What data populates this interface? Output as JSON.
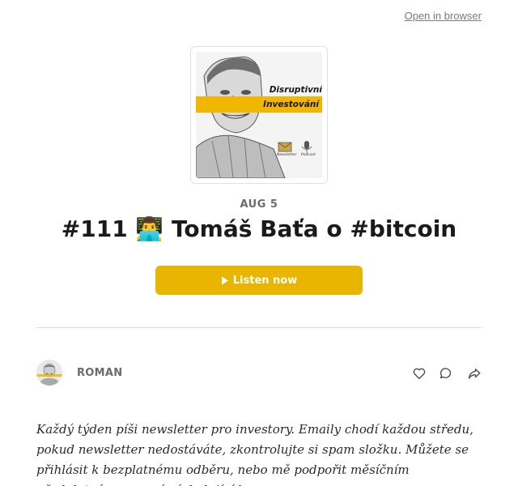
{
  "header": {
    "open_in_browser": "Open in browser"
  },
  "cover": {
    "title_line1": "Disruptivní",
    "title_line2": "Investování",
    "label_newsletter": "Newsletter",
    "label_podcast": "Podcast",
    "band_color": "#f1b600"
  },
  "post": {
    "date": "AUG 5",
    "title": "#111 👨‍💻 Tomáš Baťa o #bitcoin",
    "listen_label": "Listen now"
  },
  "author": {
    "name": "ROMAN"
  },
  "actions": {
    "icons": [
      "heart-icon",
      "comment-icon",
      "share-icon"
    ]
  },
  "body": {
    "text": "Každý týden píši newsletter pro investory. Emaily chodí každou středu, pokud newsletter nedostáváte, zkontrolujte si spam složku. Můžete se přihlásit k bezplatnému odběru, nebo mě podpořit měsíčním předplatným pomocí následující;ho"
  },
  "colors": {
    "accent": "#e8b600",
    "muted": "#6b6b6b"
  }
}
